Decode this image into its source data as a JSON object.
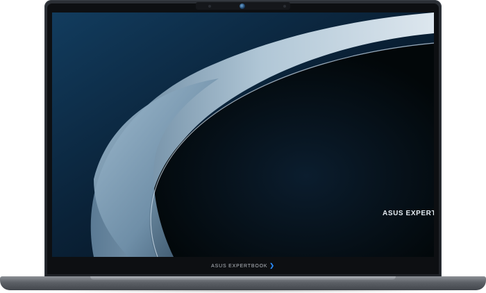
{
  "device": {
    "screen_brand_text": "ASUS EXPERTBOOK",
    "chin_brand_text": "ASUS EXPERTBOOK",
    "chevron_icon": "chevron-right-icon",
    "colors": {
      "chevron": "#2a8cff",
      "screen_bg": "#06101a",
      "body": "#1f2227"
    }
  }
}
